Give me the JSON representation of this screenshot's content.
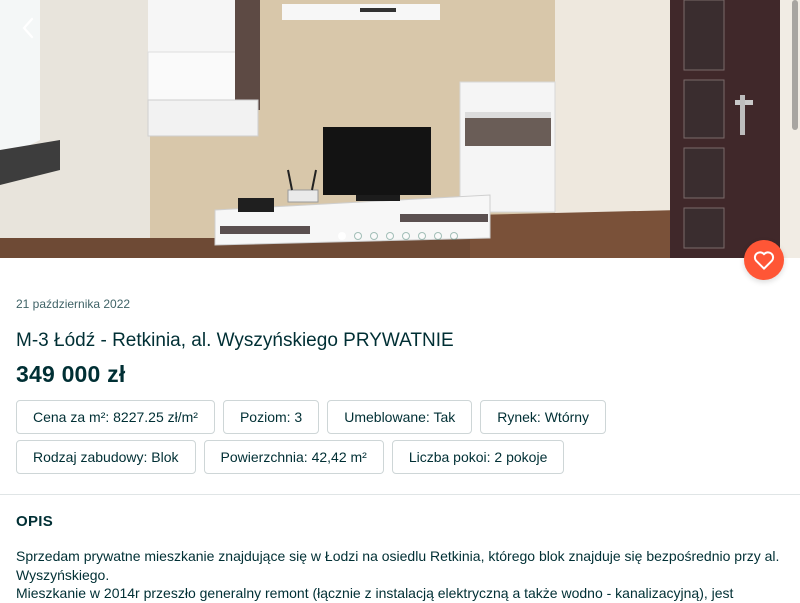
{
  "gallery": {
    "image_alt": "photo-living-room",
    "total_images": 8,
    "active_index": 1,
    "prev_icon": "chevron-left-icon"
  },
  "favorite": {
    "icon": "heart-icon",
    "color": "#ff5636"
  },
  "listing": {
    "date": "21 października 2022",
    "title": "M-3 Łódź - Retkinia, al. Wyszyńskiego PRYWATNIE",
    "price": "349 000 zł"
  },
  "params": [
    "Cena za m²: 8227.25 zł/m²",
    "Poziom: 3",
    "Umeblowane: Tak",
    "Rynek: Wtórny",
    "Rodzaj zabudowy: Blok",
    "Powierzchnia: 42,42 m²",
    "Liczba pokoi: 2 pokoje"
  ],
  "description": {
    "heading": "OPIS",
    "lines": [
      "Sprzedam prywatne mieszkanie znajdujące się w Łodzi na osiedlu Retkinia, którego blok znajduje się bezpośrednio przy al. Wyszyńskiego.",
      "Mieszkanie w 2014r przeszło generalny remont (łącznie z instalacją elektryczną a także wodno - kanalizacyjną), jest"
    ]
  },
  "colors": {
    "text": "#002f34",
    "muted": "#406367",
    "chip_border": "#ced6d7",
    "accent": "#ff5636"
  }
}
